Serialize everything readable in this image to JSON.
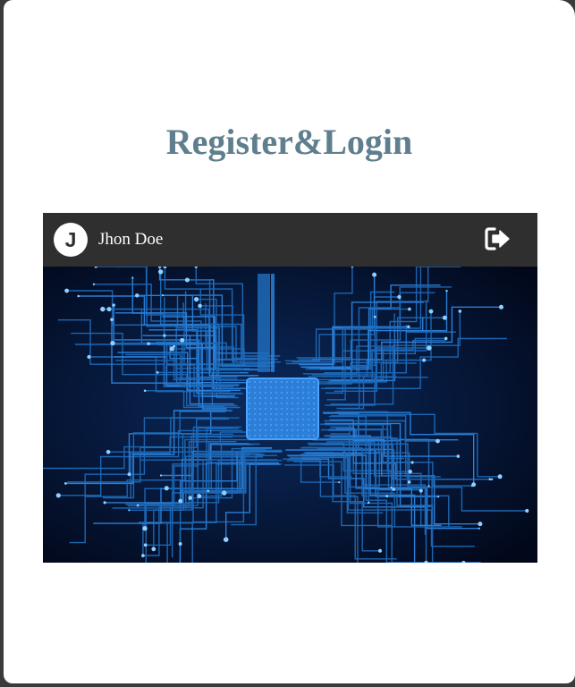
{
  "page": {
    "title": "Register&Login"
  },
  "profile": {
    "avatar_initial": "J",
    "user_name": "Jhon Doe",
    "logout_icon": "sign-out-icon",
    "image_description_icon": "circuit-board-image"
  },
  "colors": {
    "title": "#5f7f8e",
    "header_bg": "#2f2f2f",
    "circuit_trace": "#1f6fc0",
    "circuit_bg": "#000814"
  }
}
